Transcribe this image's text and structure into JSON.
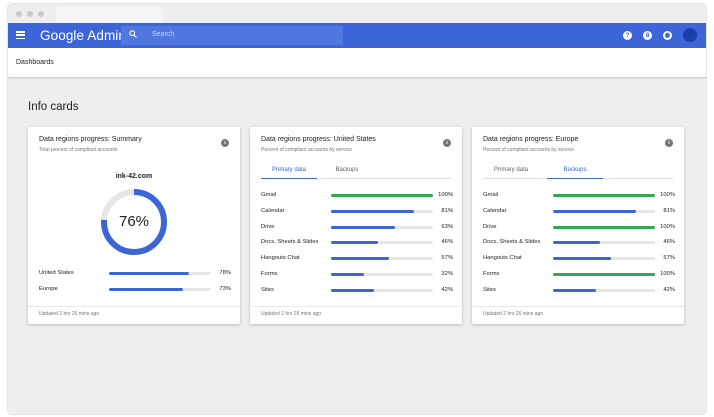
{
  "app": {
    "brand": "Google Admin",
    "search_placeholder": "Search"
  },
  "header_icons": [
    "help-icon",
    "apps-icon",
    "notifications-icon"
  ],
  "header_icon_glyphs": [
    "?",
    "8",
    "◉"
  ],
  "breadcrumb": "Dashboards",
  "section_title": "Info cards",
  "colors": {
    "primary": "#3c66d8",
    "blue_bar": "#3c66d8",
    "green_bar": "#34a853",
    "track": "#e6e6e6"
  },
  "cards": [
    {
      "title": "Data regions progress: Summary",
      "subtitle": "Total percent of compliant accounts",
      "domain": "ink-42.com",
      "donut_percent": 76,
      "donut_label": "76%",
      "rows": [
        {
          "label": "United States",
          "value": 78,
          "value_label": "78%",
          "color": "blue"
        },
        {
          "label": "Europe",
          "value": 73,
          "value_label": "73%",
          "color": "blue"
        }
      ],
      "footer": "Updated 2 hrs 26 mins ago"
    },
    {
      "title": "Data regions progress: United States",
      "subtitle": "Percent of compliant accounts by service",
      "tabs": [
        {
          "label": "Primary data",
          "active": true
        },
        {
          "label": "Backups",
          "active": false
        }
      ],
      "rows": [
        {
          "label": "Gmail",
          "value": 100,
          "value_label": "100%",
          "color": "green"
        },
        {
          "label": "Calendar",
          "value": 81,
          "value_label": "81%",
          "color": "blue"
        },
        {
          "label": "Drive",
          "value": 63,
          "value_label": "63%",
          "color": "blue"
        },
        {
          "label": "Docs, Sheets & Slides",
          "value": 46,
          "value_label": "46%",
          "color": "blue"
        },
        {
          "label": "Hangouts Chat",
          "value": 57,
          "value_label": "57%",
          "color": "blue"
        },
        {
          "label": "Forms",
          "value": 32,
          "value_label": "32%",
          "color": "blue"
        },
        {
          "label": "Sites",
          "value": 42,
          "value_label": "42%",
          "color": "blue"
        }
      ],
      "footer": "Updated 2 hrs 26 mins ago"
    },
    {
      "title": "Data regions progress: Europe",
      "subtitle": "Percent of compliant accounts by service",
      "tabs": [
        {
          "label": "Primary data",
          "active": false
        },
        {
          "label": "Backups",
          "active": true
        }
      ],
      "rows": [
        {
          "label": "Gmail",
          "value": 100,
          "value_label": "100%",
          "color": "green"
        },
        {
          "label": "Calendar",
          "value": 81,
          "value_label": "81%",
          "color": "blue"
        },
        {
          "label": "Drive",
          "value": 100,
          "value_label": "100%",
          "color": "green"
        },
        {
          "label": "Docs, Sheets & Slides",
          "value": 46,
          "value_label": "46%",
          "color": "blue"
        },
        {
          "label": "Hangouts Chat",
          "value": 57,
          "value_label": "57%",
          "color": "blue"
        },
        {
          "label": "Forms",
          "value": 100,
          "value_label": "100%",
          "color": "green"
        },
        {
          "label": "Sites",
          "value": 42,
          "value_label": "42%",
          "color": "blue"
        }
      ],
      "footer": "Updated 2 hrs 26 mins ago"
    }
  ]
}
